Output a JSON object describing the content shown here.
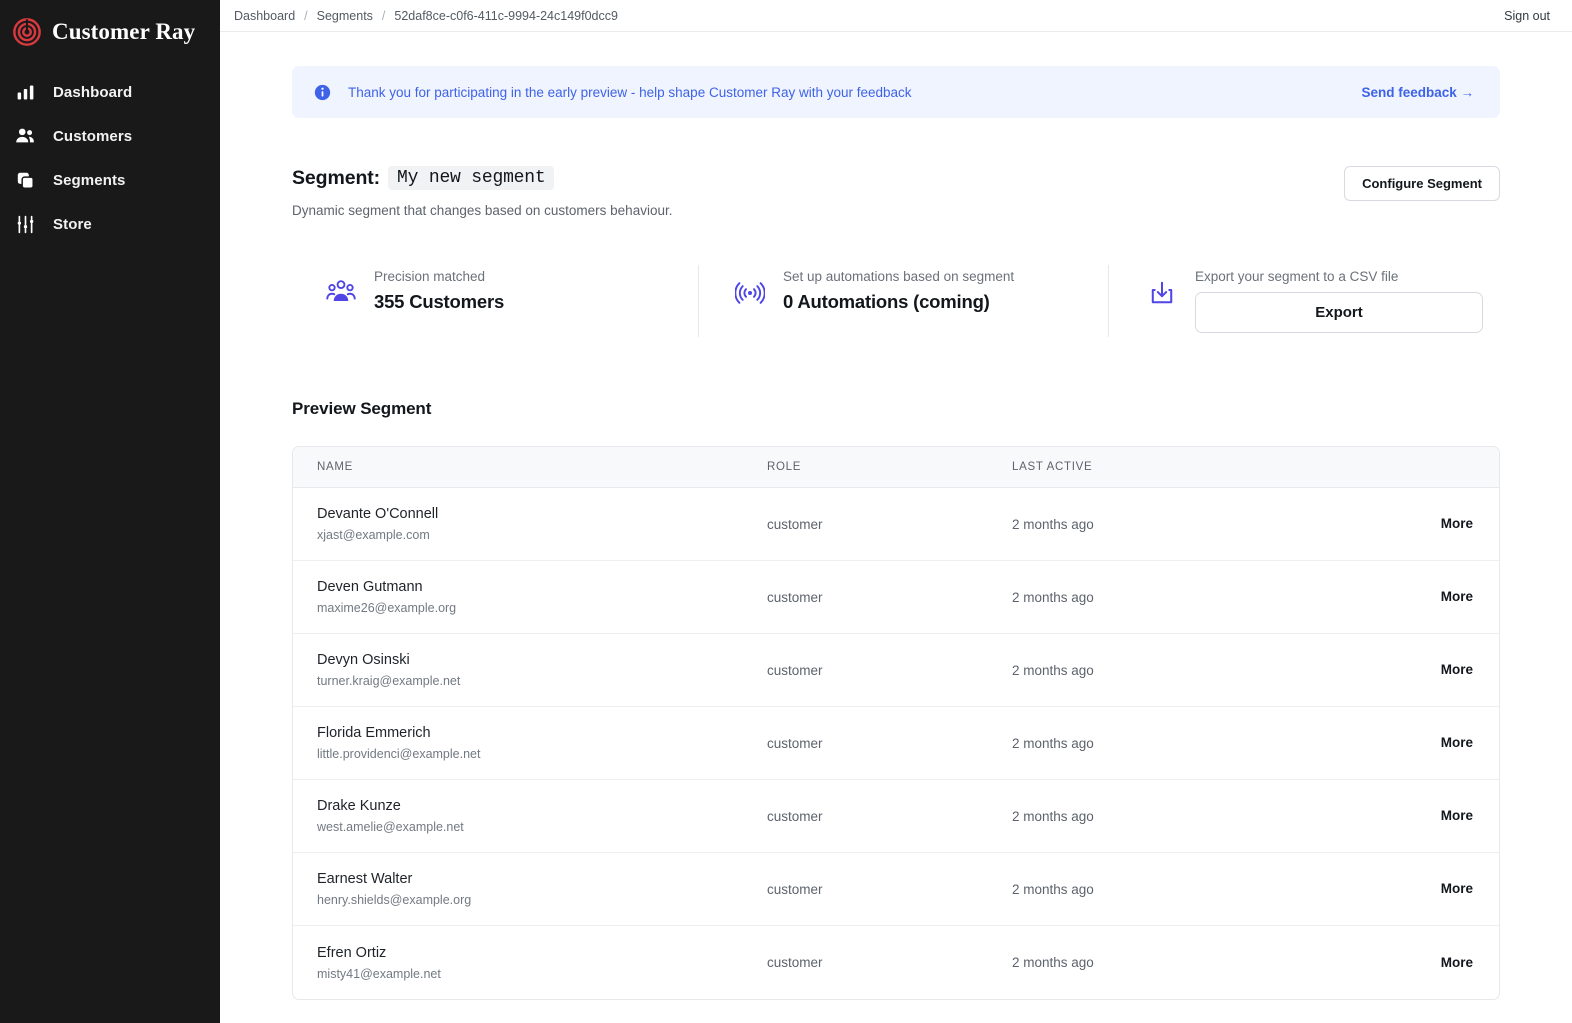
{
  "brand": {
    "name": "Customer Ray",
    "logo_icon": "target-spiral-icon",
    "logo_color": "#d8393f"
  },
  "sidebar": {
    "items": [
      {
        "label": "Dashboard",
        "icon": "bar-chart-icon"
      },
      {
        "label": "Customers",
        "icon": "users-icon"
      },
      {
        "label": "Segments",
        "icon": "layers-icon"
      },
      {
        "label": "Store",
        "icon": "sliders-icon"
      }
    ]
  },
  "topbar": {
    "breadcrumb": [
      "Dashboard",
      "Segments",
      "52daf8ce-c0f6-411c-9994-24c149f0dcc9"
    ],
    "separator": "/",
    "sign_out": "Sign out"
  },
  "banner": {
    "icon": "info-icon",
    "text": "Thank you for participating in the early preview - help shape Customer Ray with your feedback",
    "cta": "Send feedback →",
    "bg": "#eff4fe",
    "accent": "#3f63e8"
  },
  "segment": {
    "label": "Segment:",
    "name": "My new segment",
    "description": "Dynamic segment that changes based on customers behaviour.",
    "configure_button": "Configure Segment"
  },
  "stats": [
    {
      "icon": "people-group-icon",
      "caption": "Precision matched",
      "value": "355 Customers"
    },
    {
      "icon": "broadcast-icon",
      "caption": "Set up automations based on segment",
      "value": "0 Automations (coming)"
    },
    {
      "icon": "download-icon",
      "caption": "Export your segment to a CSV file",
      "button": "Export"
    }
  ],
  "accent_purple": "#4f46e5",
  "preview": {
    "title": "Preview Segment",
    "columns": [
      "NAME",
      "ROLE",
      "LAST ACTIVE",
      ""
    ],
    "more_label": "More",
    "rows": [
      {
        "name": "Devante O'Connell",
        "email": "xjast@example.com",
        "role": "customer",
        "last_active": "2 months ago",
        "more": "More"
      },
      {
        "name": "Deven Gutmann",
        "email": "maxime26@example.org",
        "role": "customer",
        "last_active": "2 months ago",
        "more": "More"
      },
      {
        "name": "Devyn Osinski",
        "email": "turner.kraig@example.net",
        "role": "customer",
        "last_active": "2 months ago",
        "more": "More"
      },
      {
        "name": "Florida Emmerich",
        "email": "little.providenci@example.net",
        "role": "customer",
        "last_active": "2 months ago",
        "more": "More"
      },
      {
        "name": "Drake Kunze",
        "email": "west.amelie@example.net",
        "role": "customer",
        "last_active": "2 months ago",
        "more": "More"
      },
      {
        "name": "Earnest Walter",
        "email": "henry.shields@example.org",
        "role": "customer",
        "last_active": "2 months ago",
        "more": "More"
      },
      {
        "name": "Efren Ortiz",
        "email": "misty41@example.net",
        "role": "customer",
        "last_active": "2 months ago",
        "more": "More"
      }
    ]
  }
}
